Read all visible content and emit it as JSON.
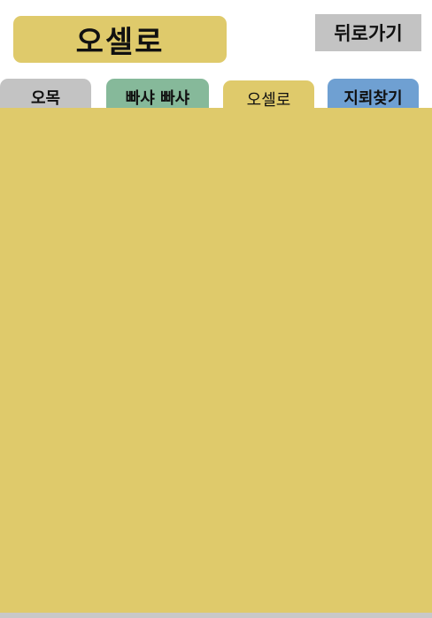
{
  "header": {
    "title": "오셀로",
    "back_label": "뒤로가기"
  },
  "tabs": [
    {
      "label": "오목",
      "color": "#c3c3c3"
    },
    {
      "label": "빠샤 빠샤",
      "color": "#86b99a"
    },
    {
      "label": "오셀로",
      "color": "#dfca6b",
      "active": true
    },
    {
      "label": "지뢰찾기",
      "color": "#6fa0d2"
    }
  ],
  "colors": {
    "accent": "#dfca6b",
    "panel": "#dfca6b",
    "button_gray": "#c3c3c3"
  }
}
